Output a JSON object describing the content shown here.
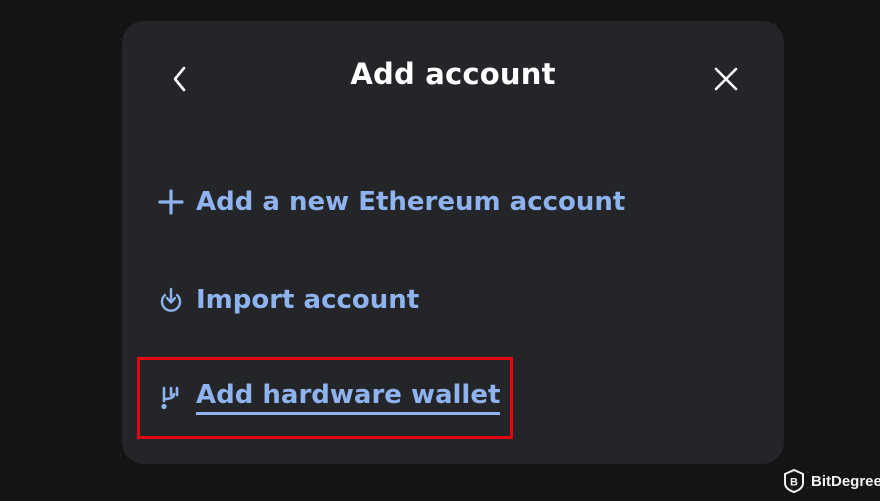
{
  "modal": {
    "title": "Add account",
    "back_icon": "chevron-left-icon",
    "close_icon": "close-icon"
  },
  "menu": {
    "items": [
      {
        "label": "Add a new Ethereum account",
        "icon": "plus-icon"
      },
      {
        "label": "Import account",
        "icon": "import-icon"
      },
      {
        "label": "Add hardware wallet",
        "icon": "hardware-wallet-icon"
      }
    ]
  },
  "colors": {
    "modal_background": "#242528",
    "accent": "#8eb3ee",
    "highlight": "#e3050f",
    "title": "#ffffff"
  },
  "watermark": {
    "brand": "BitDegree",
    "logo_icon": "bitdegree-logo-icon"
  }
}
